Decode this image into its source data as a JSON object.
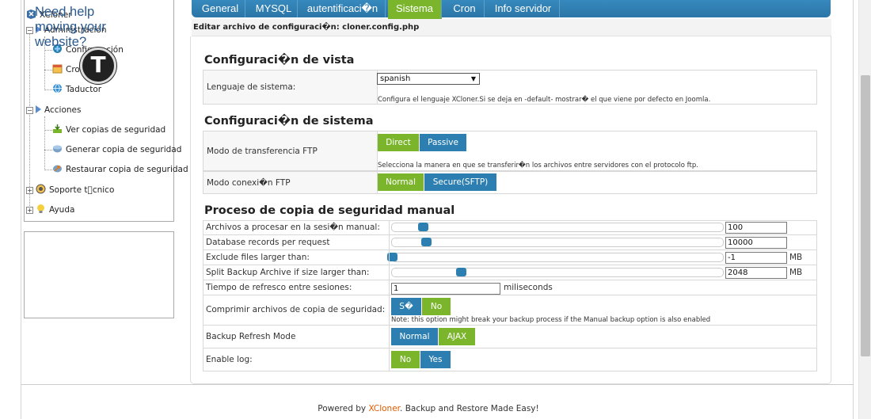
{
  "sidebar": {
    "root": "XCloner",
    "items": [
      {
        "label": "Administración",
        "icon": "folder-arrow-icon"
      },
      {
        "label": "Configuración",
        "icon": "config-icon"
      },
      {
        "label": "Cron",
        "icon": "calendar-icon"
      },
      {
        "label": "Taductor",
        "icon": "globe-icon"
      },
      {
        "label": "Acciones",
        "icon": "folder-arrow-icon"
      },
      {
        "label": "Ver copias de seguridad",
        "icon": "view-icon"
      },
      {
        "label": "Generar copia de seguridad",
        "icon": "generate-icon"
      },
      {
        "label": "Restaurar copia de seguridad",
        "icon": "restore-icon"
      },
      {
        "label": "Soporte t\u0000cnico",
        "icon": "support-icon"
      },
      {
        "label": "Ayuda",
        "icon": "bulb-icon"
      }
    ]
  },
  "help": {
    "text": "Need help moving your website?",
    "logo_letter": "T"
  },
  "tabs": [
    {
      "label": "General"
    },
    {
      "label": "MYSQL"
    },
    {
      "label": "autentificaci�n"
    },
    {
      "label": "Sistema"
    },
    {
      "label": "Cron"
    },
    {
      "label": "Info servidor"
    }
  ],
  "header": {
    "title": "Editar archivo de configuraci�n: cloner.config.php"
  },
  "vista": {
    "title": "Configuraci�n de vista",
    "lang_label": "Lenguaje de sistema:",
    "lang_value": "spanish",
    "lang_note": "Configura el lenguaje XCloner.Si se deja en -default- mostrar� el que viene por defecto en Joomla."
  },
  "sistema": {
    "title": "Configuraci�n de sistema",
    "ftp_label": "Modo de transferencia FTP",
    "ftp_opt1": "Direct",
    "ftp_opt2": "Passive",
    "ftp_note": "Selecciona la manera en que se transferir�n los archivos entre servidores con el protocolo ftp.",
    "conn_label": "Modo conexi�n FTP",
    "conn_opt1": "Normal",
    "conn_opt2": "Secure(SFTP)"
  },
  "manual": {
    "title": "Proceso de copia de seguridad manual",
    "rows": [
      {
        "label": "Archivos a procesar en la sesi�n manual:",
        "value": "100",
        "unit": ""
      },
      {
        "label": "Database records per request",
        "value": "10000",
        "unit": ""
      },
      {
        "label": "Exclude files larger than:",
        "value": "-1",
        "unit": "MB"
      },
      {
        "label": "Split Backup Archive if size larger than:",
        "value": "2048",
        "unit": "MB"
      }
    ],
    "refresh_label": "Tiempo de refresco entre sesiones:",
    "refresh_value": "1",
    "refresh_unit": "miliseconds",
    "compress_label": "Comprimir archivos de copia de seguridad:",
    "compress_opt1": "S�",
    "compress_opt2": "No",
    "compress_note": "Note: this option might break your backup process if the Manual backup option is also enabled",
    "mode_label": "Backup Refresh Mode",
    "mode_opt1": "Normal",
    "mode_opt2": "AJAX",
    "log_label": "Enable log:",
    "log_opt1": "No",
    "log_opt2": "Yes"
  },
  "footer": {
    "prefix": "Powered by ",
    "brand": "XCloner",
    "suffix": ". Backup and Restore Made Easy!"
  }
}
